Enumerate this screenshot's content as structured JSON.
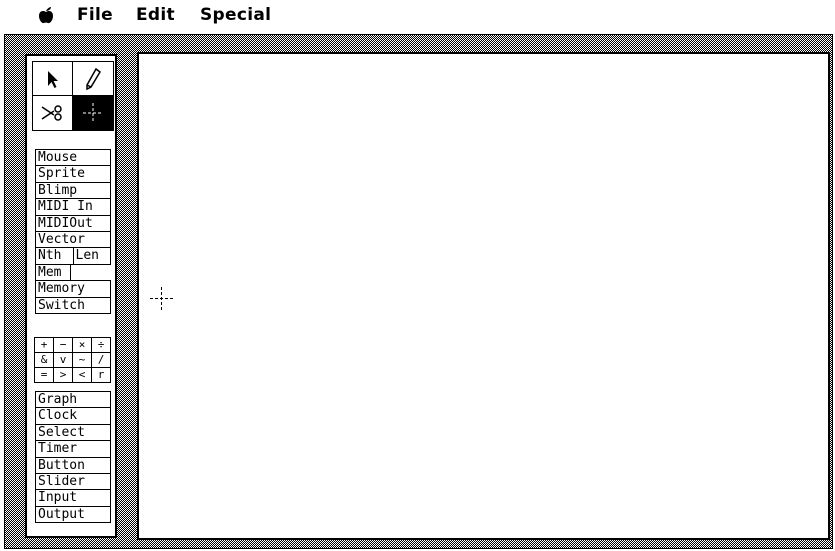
{
  "menubar": {
    "apple_icon": "apple-icon",
    "items": [
      "File",
      "Edit",
      "Special"
    ]
  },
  "palette": {
    "tools": [
      {
        "icon": "arrow-pointer-icon",
        "selected": false
      },
      {
        "icon": "pencil-icon",
        "selected": false
      },
      {
        "icon": "scissors-icon",
        "selected": false
      },
      {
        "icon": "crosshair-icon",
        "selected": true
      }
    ],
    "objects": [
      "Mouse",
      "Sprite",
      "Blimp",
      "MIDI In",
      "MIDIOut",
      "Vector"
    ],
    "nth": "Nth",
    "len": "Len",
    "mem": "Mem",
    "objects2": [
      "Memory",
      "Switch"
    ],
    "operators": [
      "+",
      "−",
      "×",
      "÷",
      "&",
      "v",
      "~",
      "/",
      "=",
      ">",
      "<",
      "r"
    ],
    "ui_objects": [
      "Graph",
      "Clock",
      "Select",
      "Timer",
      "Button",
      "Slider",
      "Input",
      "Output"
    ]
  },
  "canvas": {
    "cursor_icon": "crosshair-cursor-icon"
  },
  "colors": {
    "foreground": "#000000",
    "background": "#ffffff"
  }
}
